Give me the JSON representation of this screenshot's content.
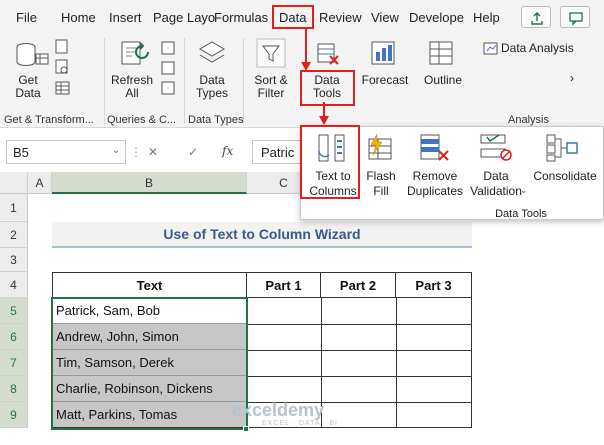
{
  "menu": [
    "File",
    "Home",
    "Insert",
    "Page Layo",
    "Formulas",
    "Data",
    "Review",
    "View",
    "Develope",
    "Help"
  ],
  "ribbon": {
    "get_data": "Get\nData",
    "refresh_all": "Refresh\nAll",
    "data_types": "Data\nTypes",
    "sort_filter": "Sort &\nFilter",
    "data_tools": "Data\nTools",
    "forecast": "Forecast",
    "outline": "Outline",
    "data_analysis": "Data Analysis",
    "groups": {
      "get_transform": "Get & Transform...",
      "queries": "Queries & C...",
      "data_types": "Data Types",
      "analysis": "Analysis"
    }
  },
  "formula_bar": {
    "name_box": "B5",
    "content": "Patric",
    "cancel": "✕",
    "enter": "✓",
    "fx": "fx"
  },
  "dropdown": {
    "items": [
      {
        "label": "Text to\nColumns"
      },
      {
        "label": "Flash\nFill"
      },
      {
        "label": "Remove\nDuplicates"
      },
      {
        "label": "Data\nValidation"
      },
      {
        "label": "Consolidate"
      }
    ],
    "group": "Data Tools"
  },
  "sheet": {
    "columns": [
      "A",
      "B",
      "C"
    ],
    "rows": [
      "1",
      "2",
      "3",
      "4",
      "5",
      "6",
      "7",
      "8",
      "9"
    ],
    "title": "Use of Text to Column Wizard",
    "headers": [
      "Text",
      "Part 1",
      "Part 2",
      "Part 3"
    ],
    "values": [
      "Patrick, Sam, Bob",
      "Andrew, John, Simon",
      "Tim, Samson, Derek",
      "Charlie, Robinson, Dickens",
      "Matt, Parkins, Tomas"
    ]
  },
  "watermark": {
    "name": "exceldemy",
    "tagline": "EXCEL · DATA · BI"
  },
  "colors": {
    "highlight": "#e0201a",
    "title": "#3a5a8c",
    "selection": "#c7c7c7",
    "green": "#217346"
  }
}
